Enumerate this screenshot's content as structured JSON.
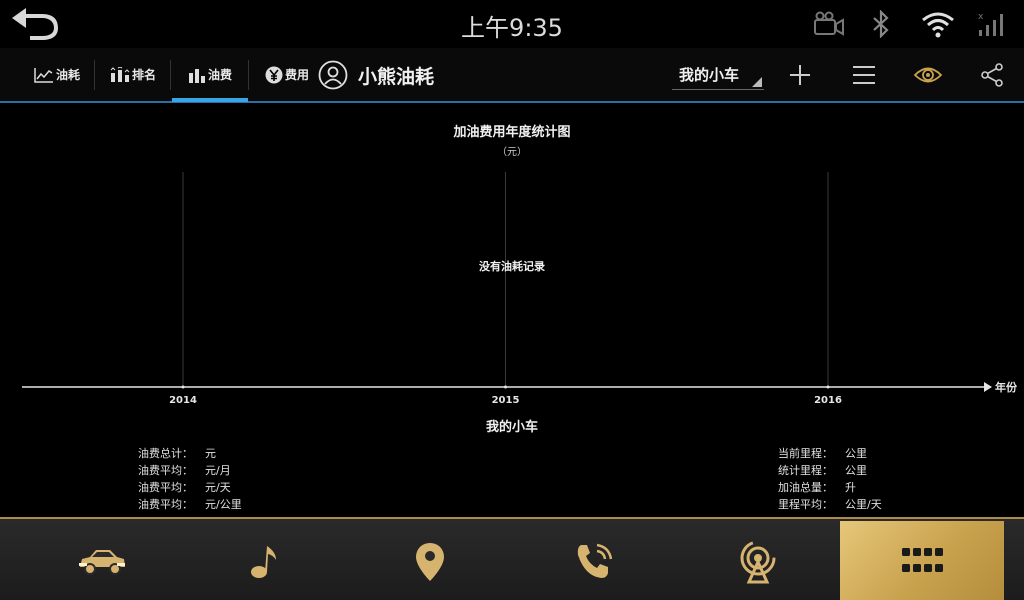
{
  "status_bar": {
    "time": "上午9:35",
    "icons": [
      "back-arrow-icon",
      "camera-icon",
      "bluetooth-icon",
      "wifi-icon",
      "signal-icon"
    ]
  },
  "tabs": [
    {
      "label": "油耗",
      "icon": "line-chart-icon"
    },
    {
      "label": "排名",
      "icon": "ranking-icon"
    },
    {
      "label": "油费",
      "icon": "bar-chart-icon",
      "active": true
    },
    {
      "label": "费用",
      "icon": "yen-icon"
    }
  ],
  "app": {
    "title": "小熊油耗",
    "car_select": "我的小车",
    "toolbar_icons": [
      "add-icon",
      "menu-icon",
      "eye-icon",
      "share-icon"
    ]
  },
  "chart_data": {
    "type": "bar",
    "title": "加油费用年度统计图",
    "unit": "（元）",
    "categories": [
      "2014",
      "2015",
      "2016"
    ],
    "values": [],
    "xlabel": "年份",
    "empty_message": "没有油耗记录"
  },
  "car_name": "我的小车",
  "stats_left": [
    {
      "label": "油费总计：",
      "value": "元"
    },
    {
      "label": "油费平均：",
      "value": "元/月"
    },
    {
      "label": "油费平均：",
      "value": "元/天"
    },
    {
      "label": "油费平均：",
      "value": "元/公里"
    }
  ],
  "stats_right": [
    {
      "label": "当前里程：",
      "value": "公里"
    },
    {
      "label": "统计里程：",
      "value": "公里"
    },
    {
      "label": "加油总量：",
      "value": "升"
    },
    {
      "label": "里程平均：",
      "value": "公里/天"
    }
  ],
  "dock": {
    "items": [
      "car-icon",
      "music-icon",
      "location-icon",
      "phone-icon",
      "radio-icon",
      "apps-icon"
    ],
    "active_index": 5
  },
  "colors": {
    "accent_blue": "#38a6e6",
    "gold": "#c9a24e",
    "background": "#000000"
  }
}
